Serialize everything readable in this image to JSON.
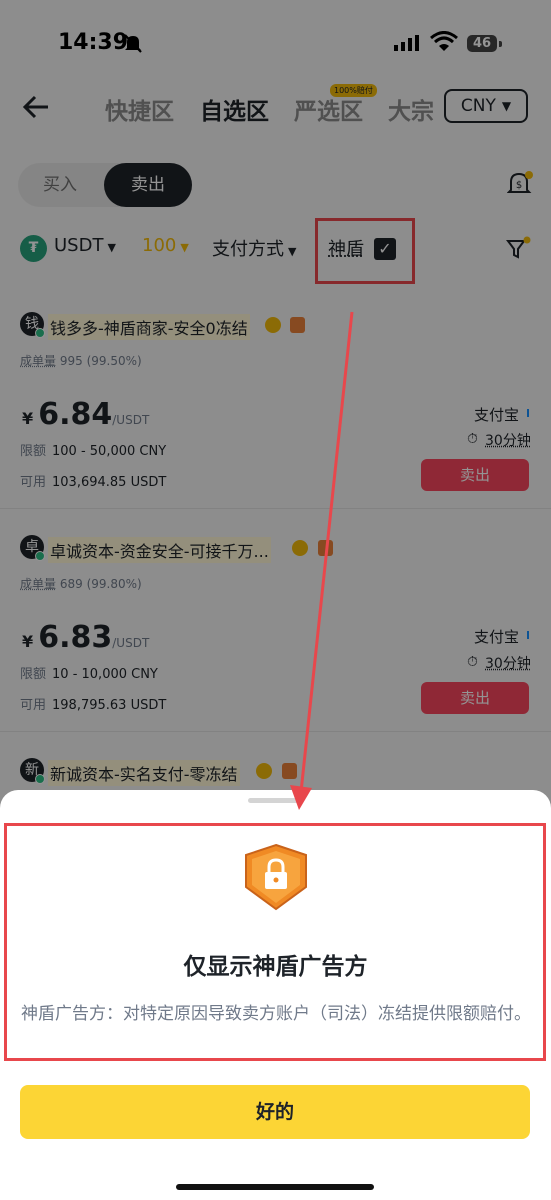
{
  "status_bar": {
    "time": "14:39",
    "battery": "46"
  },
  "header": {
    "tabs": [
      "快捷区",
      "自选区",
      "严选区",
      "大宗"
    ],
    "active_tab": "自选区",
    "tab_badge": "100%赔付",
    "currency": "CNY"
  },
  "trade_toggle": {
    "buy": "买入",
    "sell": "卖出",
    "selected": "卖出"
  },
  "filters": {
    "coin": "USDT",
    "amount": "100",
    "payment": "支付方式",
    "shield_label": "神盾",
    "shield_checked": true
  },
  "ads": [
    {
      "avatar": "钱",
      "name": "钱多多-神盾商家-安全0冻结",
      "orders_label": "成单量",
      "orders": "995 (99.50%)",
      "currency_symbol": "¥",
      "price": "6.84",
      "price_unit": "/USDT",
      "limit_label": "限额",
      "limit": "100 - 50,000 CNY",
      "available_label": "可用",
      "available": "103,694.85 USDT",
      "payment": "支付宝",
      "time": "30分钟",
      "action": "卖出"
    },
    {
      "avatar": "卓",
      "name": "卓诚资本-资金安全-可接千万...",
      "orders_label": "成单量",
      "orders": "689 (99.80%)",
      "currency_symbol": "¥",
      "price": "6.83",
      "price_unit": "/USDT",
      "limit_label": "限额",
      "limit": "10 - 10,000 CNY",
      "available_label": "可用",
      "available": "198,795.63 USDT",
      "payment": "支付宝",
      "time": "30分钟",
      "action": "卖出"
    },
    {
      "avatar": "新",
      "name": "新诚资本-实名支付-零冻结"
    }
  ],
  "sheet": {
    "title": "仅显示神盾广告方",
    "description": "神盾广告方：对特定原因导致卖方账户（司法）冻结提供限额赔付。",
    "ok": "好的"
  },
  "colors": {
    "accent_yellow": "#fcd535",
    "sell_red": "#f6465d",
    "annotation_red": "#e8474c",
    "shield_orange": "#f08a24"
  }
}
